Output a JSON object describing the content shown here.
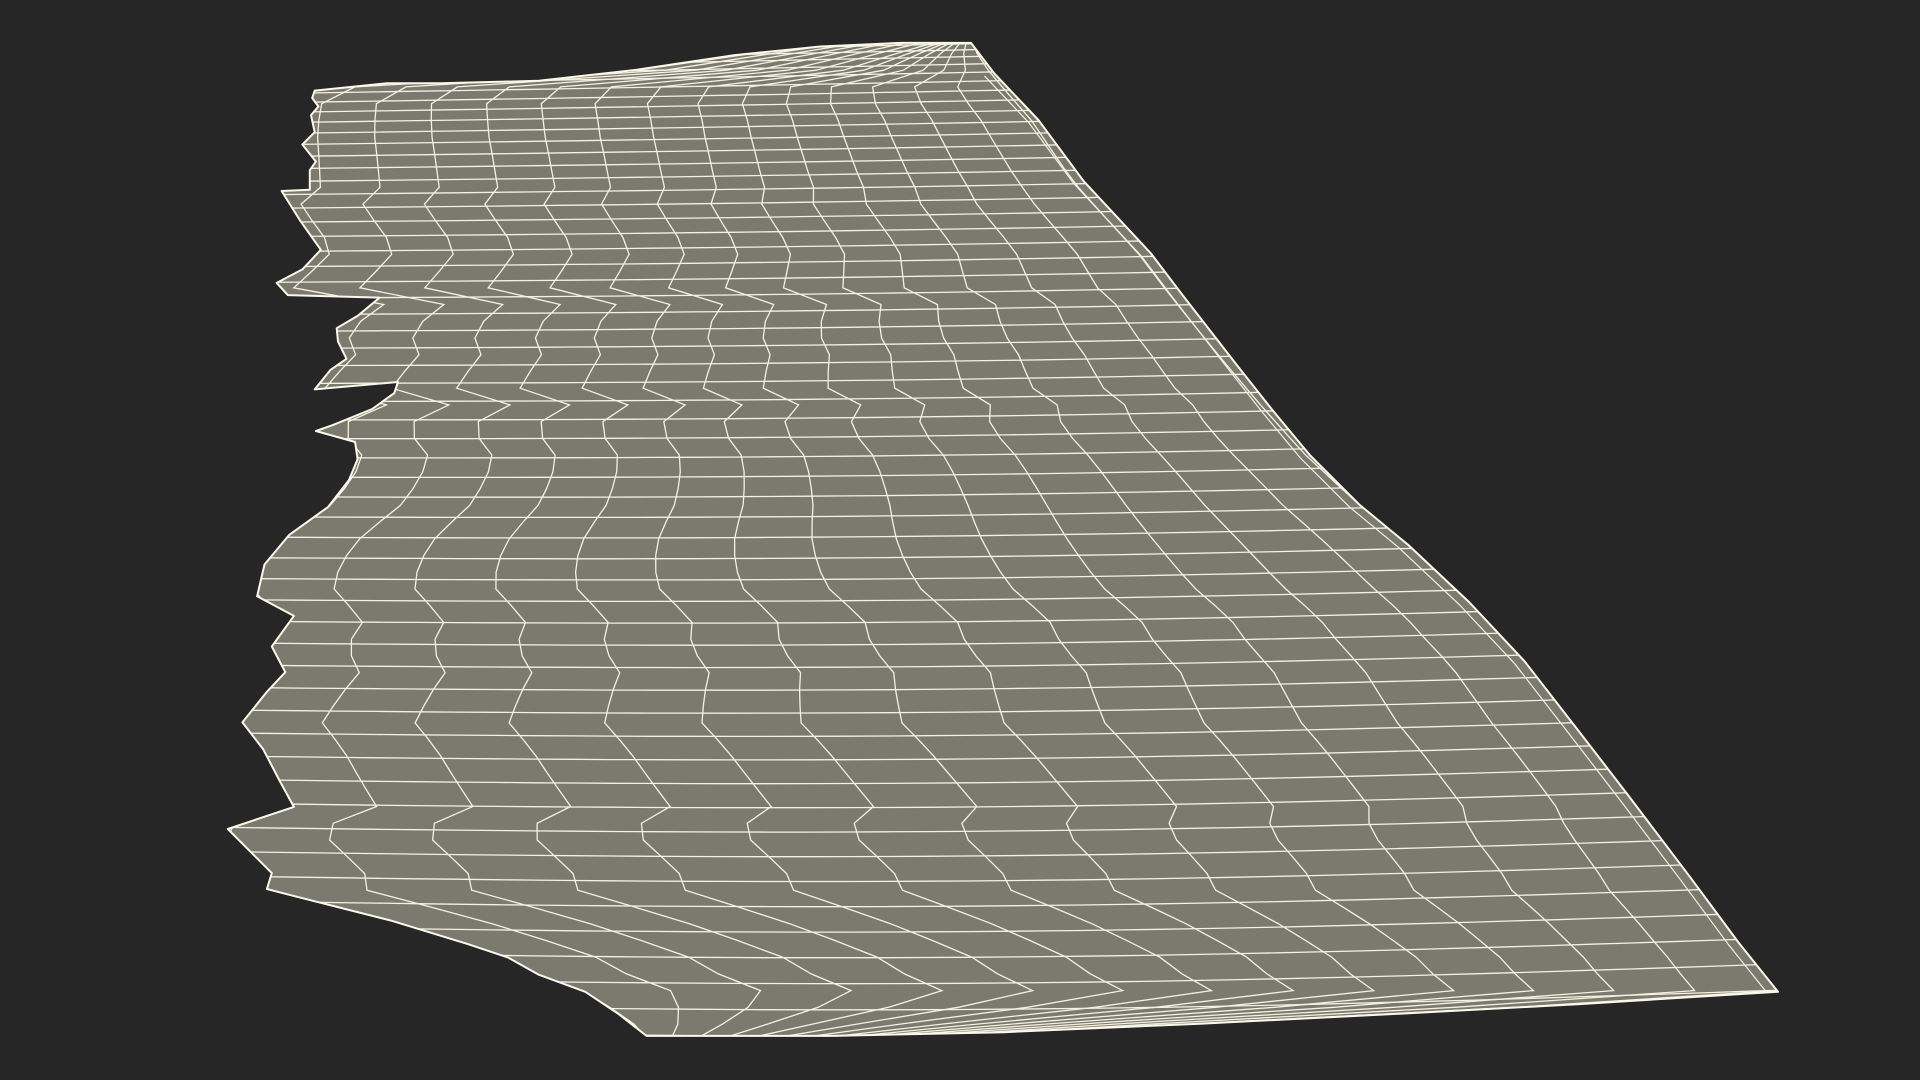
{
  "scene": {
    "subject": "wireframe-mesh-fabric",
    "background_color": "#262626",
    "surface_color": "#7a7b6e",
    "wire_color": "#f4f1e3",
    "edge_highlight_color": "#fbf8ea"
  }
}
